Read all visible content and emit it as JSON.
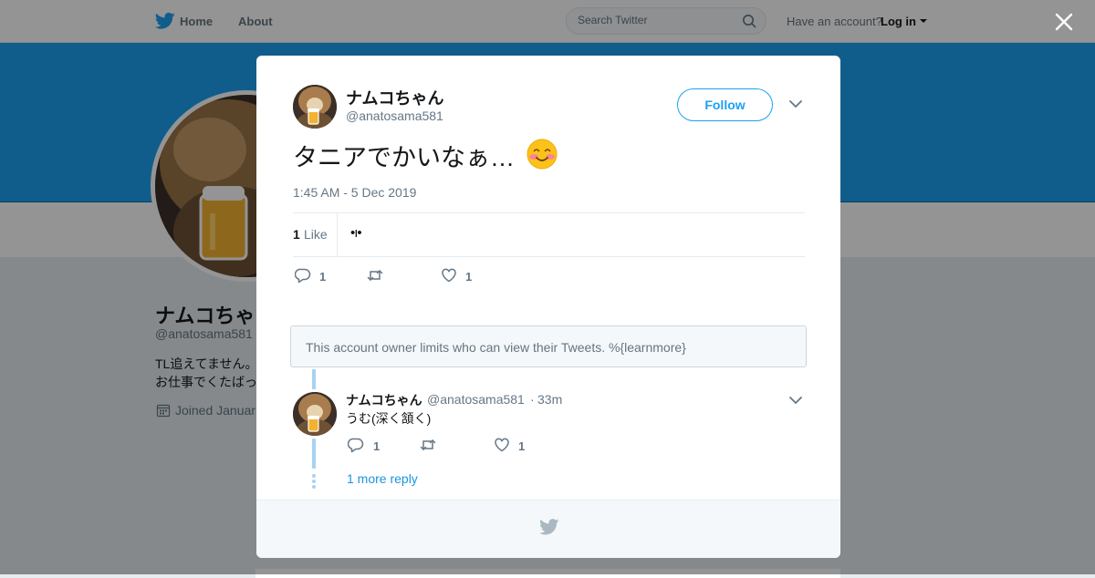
{
  "nav": {
    "home_label": "Home",
    "about_label": "About",
    "search_placeholder": "Search Twitter",
    "have_account": "Have an account?",
    "login_label": "Log in"
  },
  "profile": {
    "name": "ナムコちゃ",
    "handle": "@anatosama581",
    "bio_line1": "TL追えてません。",
    "bio_line2": "お仕事でくたばっ",
    "joined": "Joined Januar"
  },
  "tweet": {
    "author_name": "ナムコちゃん",
    "author_handle": "@anatosama581",
    "follow_label": "Follow",
    "text": "タニアでかいなぁ…",
    "emoji": "smiling-face-with-blushing-cheeks",
    "timestamp": "1:45 AM - 5 Dec 2019",
    "likes_count": "1",
    "likes_label": "Like",
    "liker_avatars": "•ı•",
    "reply_count": "1",
    "like_count": "1"
  },
  "notice": {
    "text": "This account owner limits who can view their Tweets. %{learnmore}"
  },
  "reply": {
    "author_name": "ナムコちゃん",
    "author_handle": "@anatosama581",
    "separator": "·",
    "time": "33m",
    "text": "うむ(深く頷く)",
    "reply_count": "1",
    "like_count": "1",
    "more_replies": "1 more reply"
  },
  "colors": {
    "brand": "#1da1f2",
    "link": "#1b95e0",
    "muted": "#657786",
    "thread": "#a6d3f2"
  },
  "icons": [
    "twitter-bird-icon",
    "search-icon",
    "close-icon",
    "chevron-down-icon",
    "reply-icon",
    "retweet-icon",
    "heart-icon",
    "calendar-icon"
  ]
}
